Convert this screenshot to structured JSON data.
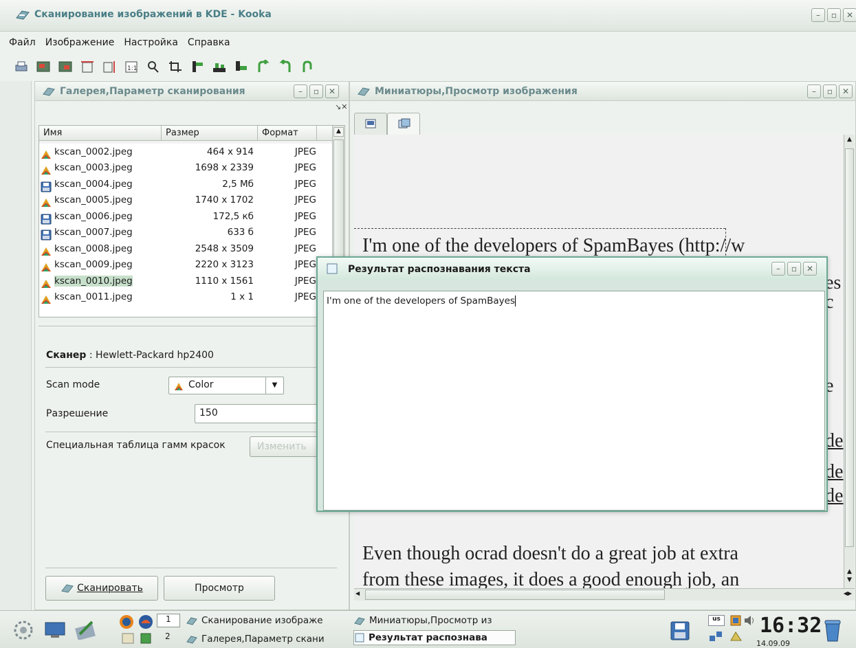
{
  "window": {
    "title": "Сканирование изображений в KDE - Kooka"
  },
  "menubar": {
    "items": [
      "Файл",
      "Изображение",
      "Настройка",
      "Справка"
    ]
  },
  "toolbar": {
    "icons": [
      "print-icon",
      "scan-to-gallery-icon",
      "scan-from-gallery-icon",
      "fit-width-icon",
      "fit-height-icon",
      "original-size-icon",
      "zoom-icon",
      "crop-icon",
      "mirror-vertical-icon",
      "mirror-horizontal-icon",
      "mirror-both-icon",
      "rotate-clockwise-icon",
      "rotate-counterclockwise-icon",
      "rotate-180-icon"
    ]
  },
  "gallery_panel": {
    "title": "Галерея,Параметр сканирования",
    "columns": [
      "Имя",
      "Размер",
      "Формат"
    ],
    "files": [
      {
        "name": "kscan_0002.jpeg",
        "size": "464 x 914",
        "format": "JPEG",
        "icon": "image-icon"
      },
      {
        "name": "kscan_0003.jpeg",
        "size": "1698 x 2339",
        "format": "JPEG",
        "icon": "image-icon"
      },
      {
        "name": "kscan_0004.jpeg",
        "size": "2,5 Мб",
        "format": "JPEG",
        "icon": "floppy-icon"
      },
      {
        "name": "kscan_0005.jpeg",
        "size": "1740 x 1702",
        "format": "JPEG",
        "icon": "image-icon"
      },
      {
        "name": "kscan_0006.jpeg",
        "size": "172,5 кб",
        "format": "JPEG",
        "icon": "floppy-icon"
      },
      {
        "name": "kscan_0007.jpeg",
        "size": "633 б",
        "format": "JPEG",
        "icon": "floppy-icon"
      },
      {
        "name": "kscan_0008.jpeg",
        "size": "2548 x 3509",
        "format": "JPEG",
        "icon": "image-icon"
      },
      {
        "name": "kscan_0009.jpeg",
        "size": "2220 x 3123",
        "format": "JPEG",
        "icon": "image-icon"
      },
      {
        "name": "kscan_0010.jpeg",
        "size": "1110 x 1561",
        "format": "JPEG",
        "icon": "image-icon"
      },
      {
        "name": "kscan_0011.jpeg",
        "size": "1 x 1",
        "format": "JPEG",
        "icon": "image-icon"
      }
    ],
    "selected_file": "kscan_0010.jpeg",
    "scanner_label": "Сканер",
    "scanner_value": " : Hewlett-Packard hp2400",
    "scan_mode_label": "Scan mode",
    "scan_mode_value": "Color",
    "resolution_label": "Разрешение",
    "resolution_value": "150",
    "gamma_label": "Специальная таблица гамм красок",
    "gamma_button": "Изменить",
    "scan_button": "Сканировать",
    "preview_button": "Просмотр"
  },
  "preview_panel": {
    "title": "Миниатюры,Просмотр изображения",
    "tabs": [
      "preview-tab",
      "thumbnails-tab"
    ],
    "document_lines": [
      "I'm one of the developers of SpamBayes (http://w",
      "Even though ocrad doesn't do a great job at extra",
      "from these images, it does a good enough job, an"
    ],
    "side_fragments": [
      "es",
      "c",
      "e",
      "de",
      "de",
      "de"
    ]
  },
  "ocr_dialog": {
    "title": "Результат распознавания текста",
    "text": "I'm one of the developers of SpamBayes"
  },
  "taskbar": {
    "desktops": [
      "1",
      "2"
    ],
    "tasks": [
      "Сканирование изображе",
      "Галерея,Параметр скани",
      "Миниатюры,Просмотр из",
      "Результат распознава"
    ],
    "keyboard_layout": "us",
    "clock": "16:32",
    "date": "14.09.09"
  },
  "colors": {
    "accent": "#4a7f87",
    "dialog_border": "#6aa894",
    "selection": "#c7e0cb"
  }
}
